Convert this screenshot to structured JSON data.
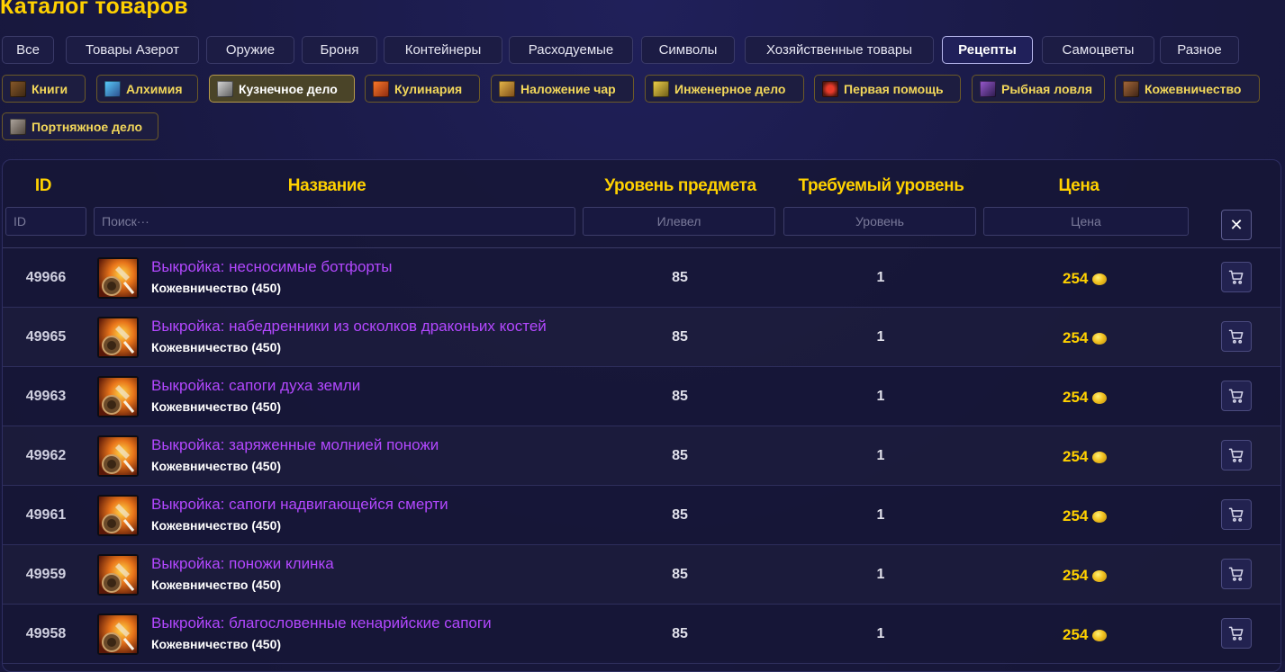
{
  "page_title": "Каталог товаров",
  "categories": [
    {
      "label": "Все"
    },
    {
      "label": "Товары Азерот"
    },
    {
      "label": "Оружие"
    },
    {
      "label": "Броня"
    },
    {
      "label": "Контейнеры"
    },
    {
      "label": "Расходуемые"
    },
    {
      "label": "Символы"
    },
    {
      "label": "Хозяйственные товары"
    },
    {
      "label": "Рецепты",
      "active": true
    },
    {
      "label": "Самоцветы"
    },
    {
      "label": "Разное"
    }
  ],
  "subcategories": [
    {
      "label": "Книги",
      "icon": "book-icon"
    },
    {
      "label": "Алхимия",
      "icon": "alchemy-icon"
    },
    {
      "label": "Кузнечное дело",
      "icon": "blacksmithing-icon",
      "active": true
    },
    {
      "label": "Кулинария",
      "icon": "cooking-icon"
    },
    {
      "label": "Наложение чар",
      "icon": "enchanting-icon"
    },
    {
      "label": "Инженерное дело",
      "icon": "engineering-icon"
    },
    {
      "label": "Первая помощь",
      "icon": "first-aid-icon"
    },
    {
      "label": "Рыбная ловля",
      "icon": "fishing-icon"
    },
    {
      "label": "Кожевничество",
      "icon": "leatherworking-icon"
    },
    {
      "label": "Портняжное дело",
      "icon": "tailoring-icon"
    }
  ],
  "table": {
    "headers": {
      "id": "ID",
      "name": "Название",
      "item_level": "Уровень предмета",
      "required_level": "Требуемый уровень",
      "price": "Цена"
    },
    "filters": {
      "id": "ID",
      "name": "Поиск···",
      "item_level": "Илевел",
      "required_level": "Уровень",
      "price": "Цена"
    },
    "clear_label": "✕",
    "rows": [
      {
        "id": "49966",
        "name": "Выкройка: несносимые ботфорты",
        "sub": "Кожевничество (450)",
        "ilvl": "85",
        "req": "1",
        "price": "254"
      },
      {
        "id": "49965",
        "name": "Выкройка: набедренники из осколков драконьих костей",
        "sub": "Кожевничество (450)",
        "ilvl": "85",
        "req": "1",
        "price": "254"
      },
      {
        "id": "49963",
        "name": "Выкройка: сапоги духа земли",
        "sub": "Кожевничество (450)",
        "ilvl": "85",
        "req": "1",
        "price": "254"
      },
      {
        "id": "49962",
        "name": "Выкройка: заряженные молнией поножи",
        "sub": "Кожевничество (450)",
        "ilvl": "85",
        "req": "1",
        "price": "254"
      },
      {
        "id": "49961",
        "name": "Выкройка: сапоги надвигающейся смерти",
        "sub": "Кожевничество (450)",
        "ilvl": "85",
        "req": "1",
        "price": "254"
      },
      {
        "id": "49959",
        "name": "Выкройка: поножи клинка",
        "sub": "Кожевничество (450)",
        "ilvl": "85",
        "req": "1",
        "price": "254"
      },
      {
        "id": "49958",
        "name": "Выкройка: благословенные кенарийские сапоги",
        "sub": "Кожевничество (450)",
        "ilvl": "85",
        "req": "1",
        "price": "254"
      }
    ]
  },
  "colors": {
    "accent_gold": "#ffd100",
    "item_epic": "#b348ff",
    "background": "#1a1a45"
  },
  "icons": {
    "price": "gold-coin-icon",
    "row_action": "cart-icon",
    "item": "recipe-pattern-icon"
  }
}
